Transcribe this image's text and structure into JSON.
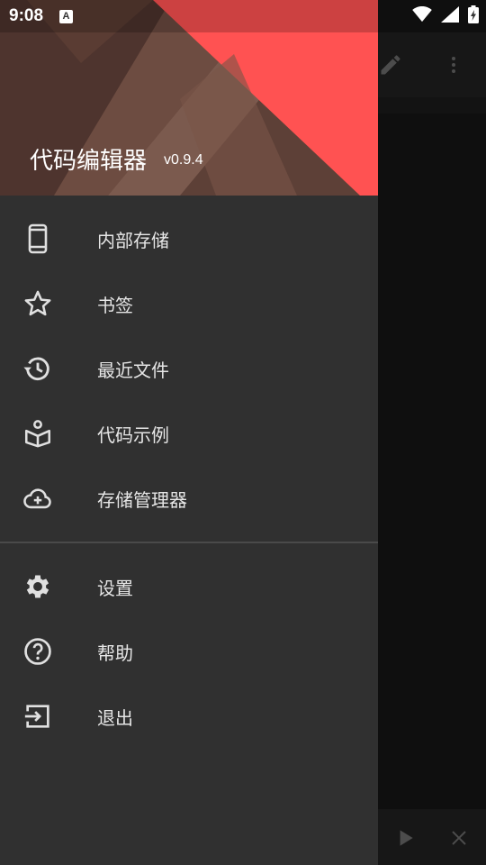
{
  "status_bar": {
    "time": "9:08",
    "notification_letter": "A"
  },
  "drawer": {
    "header": {
      "title": "代码编辑器",
      "version": "v0.9.4"
    },
    "items": [
      {
        "label": "内部存储",
        "icon": "phone-icon"
      },
      {
        "label": "书签",
        "icon": "star-icon"
      },
      {
        "label": "最近文件",
        "icon": "history-icon"
      },
      {
        "label": "代码示例",
        "icon": "book-icon"
      },
      {
        "label": "存储管理器",
        "icon": "cloud-add-icon"
      }
    ],
    "secondary_items": [
      {
        "label": "设置",
        "icon": "gear-icon"
      },
      {
        "label": "帮助",
        "icon": "help-icon"
      },
      {
        "label": "退出",
        "icon": "exit-icon"
      }
    ]
  },
  "colors": {
    "drawer_bg": "#303030",
    "header_accent": "#ff5252",
    "header_brown": "#6d4c41",
    "icon_color": "#e0e0e0"
  }
}
